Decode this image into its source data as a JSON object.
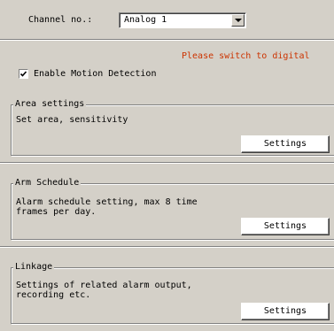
{
  "channel": {
    "label": "Channel no.:",
    "selected": "Analog 1",
    "dropdown_icon": "chevron-down-icon"
  },
  "warning": "Please switch to digital",
  "motion_detection": {
    "label": "Enable Motion Detection",
    "checked": true
  },
  "area_settings": {
    "title": "Area settings",
    "description": "Set area, sensitivity",
    "button": "Settings"
  },
  "arm_schedule": {
    "title": "Arm Schedule",
    "description": "Alarm schedule setting, max 8 time\nframes per day.",
    "button": "Settings"
  },
  "linkage": {
    "title": "Linkage",
    "description": "Settings of related alarm output,\nrecording etc.",
    "button": "Settings"
  },
  "colors": {
    "background": "#d4d0c8",
    "warning": "#cc3300"
  }
}
